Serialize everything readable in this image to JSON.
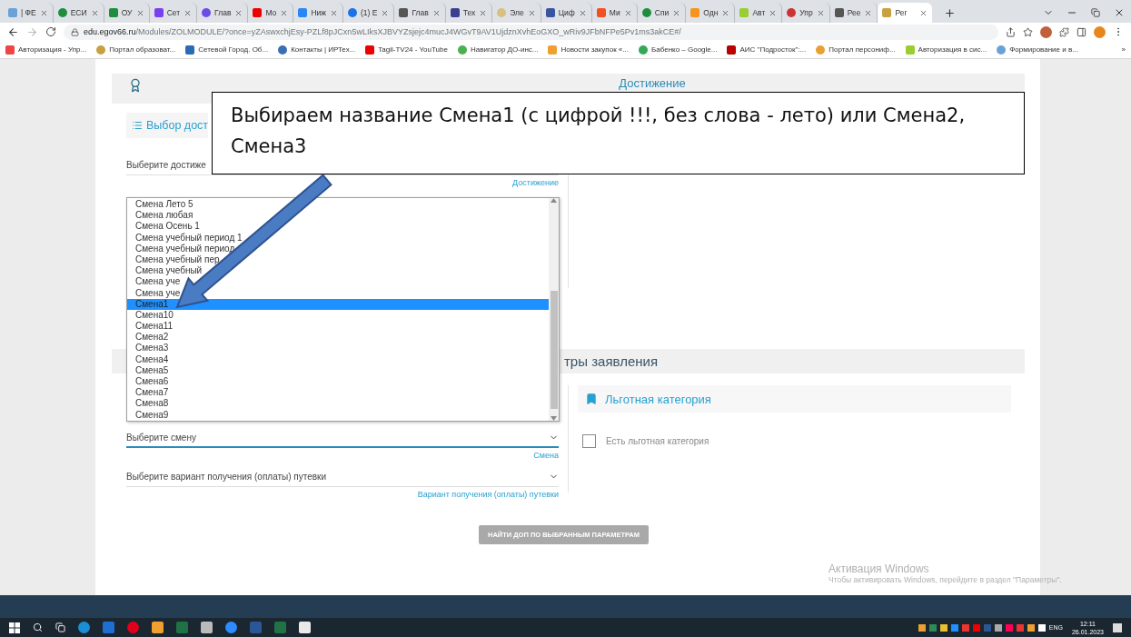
{
  "browser": {
    "tabs": [
      {
        "label": "| ФЕ",
        "selected": false
      },
      {
        "label": "ЕСИ",
        "selected": false
      },
      {
        "label": "ОУ",
        "selected": false
      },
      {
        "label": "Сет",
        "selected": false
      },
      {
        "label": "Глав",
        "selected": false
      },
      {
        "label": "Мо",
        "selected": false
      },
      {
        "label": "Ниж",
        "selected": false
      },
      {
        "label": "(1) Е",
        "selected": false
      },
      {
        "label": "Глав",
        "selected": false
      },
      {
        "label": "Тех",
        "selected": false
      },
      {
        "label": "Эле",
        "selected": false
      },
      {
        "label": "Циф",
        "selected": false
      },
      {
        "label": "Ми",
        "selected": false
      },
      {
        "label": "Спи",
        "selected": false
      },
      {
        "label": "Одн",
        "selected": false
      },
      {
        "label": "Авт",
        "selected": false
      },
      {
        "label": "Упр",
        "selected": false
      },
      {
        "label": "Рее",
        "selected": false
      },
      {
        "label": "Рег",
        "selected": true
      }
    ],
    "address_host": "edu.egov66.ru",
    "address_path": "/Modules/ZOLMODULE/?once=yZAswxchjEsy-PZLf8pJCxn5wLIksXJBVYZsjejc4mucJ4WGvT9AV1UjdznXvhEoGXO_wRiv9JFbNFPe5Pv1ms3akCE#/",
    "bookmarks": [
      "Авторизация - Упр...",
      "Портал образоват...",
      "Сетевой Город. Об...",
      "Контакты | ИРТех...",
      "Tagil-TV24 - YouTube",
      "Навигатор ДО-инс...",
      "Новости закупок «...",
      "Бабенко – Google...",
      "АИС \"Подросток\":...",
      "Портал персониф...",
      "Авторизация в сис...",
      "Формирование и в..."
    ],
    "bookmarks_more": "»"
  },
  "page": {
    "header_title": "Достижение",
    "nav_label": "Выбор дост",
    "achievement_select": "Выберите достиже",
    "achievement_caption": "Достижение",
    "dropdown": [
      {
        "label": "Смена Лето 5",
        "selected": false
      },
      {
        "label": "Смена любая",
        "selected": false
      },
      {
        "label": "Смена Осень 1",
        "selected": false
      },
      {
        "label": "Смена учебный период 1",
        "selected": false
      },
      {
        "label": "Смена учебный период",
        "selected": false
      },
      {
        "label": "Смена учебный пер",
        "selected": false
      },
      {
        "label": "Смена учебный",
        "selected": false
      },
      {
        "label": "Смена уче",
        "selected": false
      },
      {
        "label": "Смена уче",
        "selected": false
      },
      {
        "label": "Смена1",
        "selected": true
      },
      {
        "label": "Смена10",
        "selected": false
      },
      {
        "label": "Смена11",
        "selected": false
      },
      {
        "label": "Смена2",
        "selected": false
      },
      {
        "label": "Смена3",
        "selected": false
      },
      {
        "label": "Смена4",
        "selected": false
      },
      {
        "label": "Смена5",
        "selected": false
      },
      {
        "label": "Смена6",
        "selected": false
      },
      {
        "label": "Смена7",
        "selected": false
      },
      {
        "label": "Смена8",
        "selected": false
      },
      {
        "label": "Смена9",
        "selected": false
      }
    ],
    "section_title": "тры заявления",
    "shift_select": {
      "value": "Выберите смену",
      "caption": "Смена",
      "focused": true
    },
    "payment_select": {
      "value": "Выберите вариант получения (оплаты) путевки",
      "caption": "Вариант получения (оплаты) путевки",
      "focused": false
    },
    "benefit_title": "Льготная категория",
    "benefit_checkbox": {
      "label": "Есть льготная категория",
      "checked": false
    },
    "search_button": "НАЙТИ ДОП ПО ВЫБРАННЫМ ПАРАМЕТРАМ"
  },
  "callout": "Выбираем название Смена1 (с цифрой !!!, без слова - лето) или Смена2, Смена3",
  "os_notice": {
    "title": "Активация Windows",
    "text": "Чтобы активировать Windows, перейдите в раздел \"Параметры\"."
  },
  "taskbar": {
    "language": "ENG",
    "time": "12:11",
    "date": "26.01.2023"
  }
}
